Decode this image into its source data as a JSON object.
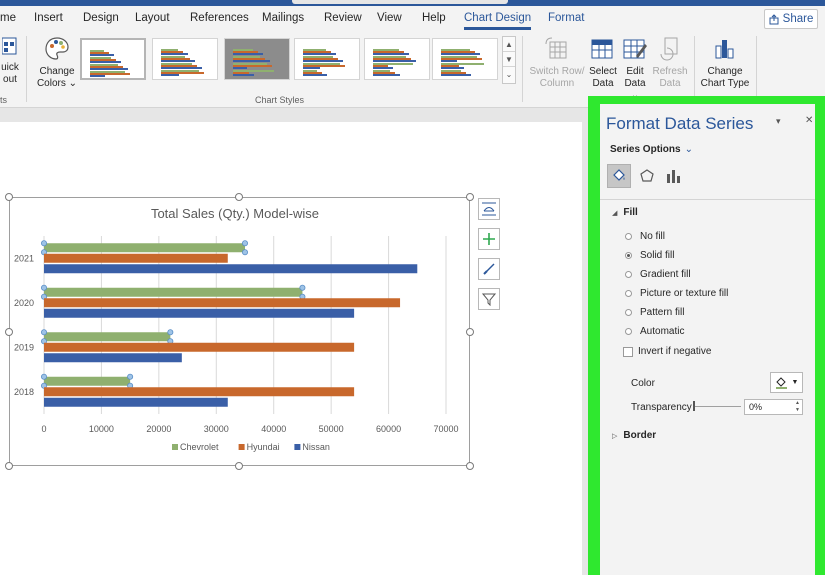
{
  "ribbon_tabs": [
    "me",
    "Insert",
    "Design",
    "Layout",
    "References",
    "Mailings",
    "Review",
    "View",
    "Help",
    "Chart Design",
    "Format"
  ],
  "active_tab": "Chart Design",
  "share_label": "Share",
  "ribbon": {
    "quick_layout_line1": "uick",
    "quick_layout_line2": "out",
    "change_colors_line1": "Change",
    "change_colors_line2": "Colors",
    "left_group_fragment": "ts",
    "chart_styles_group": "Chart Styles",
    "switch_row_line1": "Switch Row/",
    "switch_row_line2": "Column",
    "select_data_line1": "Select",
    "select_data_line2": "Data",
    "edit_data_line1": "Edit",
    "edit_data_line2": "Data",
    "refresh_data_line1": "Refresh",
    "refresh_data_line2": "Data",
    "change_type_line1": "Change",
    "change_type_line2": "Chart Type"
  },
  "chart_data": {
    "type": "bar",
    "orientation": "horizontal",
    "title": "Total Sales (Qty.) Model-wise",
    "categories": [
      "2018",
      "2019",
      "2020",
      "2021"
    ],
    "series": [
      {
        "name": "Chevrolet",
        "color": "#8fb06f",
        "values": [
          15000,
          22000,
          45000,
          35000
        ]
      },
      {
        "name": "Hyundai",
        "color": "#c8682c",
        "values": [
          54000,
          54000,
          62000,
          32000
        ]
      },
      {
        "name": "Nissan",
        "color": "#3a5fa7",
        "values": [
          32000,
          24000,
          54000,
          65000
        ]
      }
    ],
    "x_ticks": [
      "0",
      "10000",
      "20000",
      "30000",
      "40000",
      "50000",
      "60000",
      "70000"
    ],
    "xlim": [
      0,
      70000
    ],
    "grid": true,
    "legend_position": "bottom",
    "selected_series": "Chevrolet"
  },
  "pane": {
    "title": "Format Data Series",
    "series_options": "Series Options",
    "fill_section": "Fill",
    "fill_options": [
      "No fill",
      "Solid fill",
      "Gradient fill",
      "Picture or texture fill",
      "Pattern fill",
      "Automatic"
    ],
    "selected_fill": "Solid fill",
    "invert_label": "Invert if negative",
    "color_label": "Color",
    "transparency_label": "Transparency",
    "transparency_value": "0%",
    "border_section": "Border",
    "accent_color": "#2fe82f"
  }
}
